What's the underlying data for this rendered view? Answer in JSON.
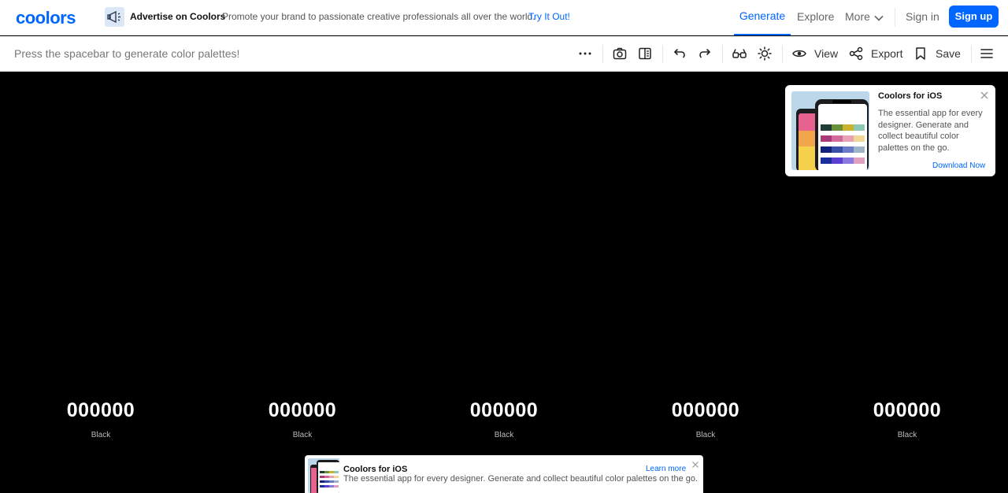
{
  "header": {
    "logo": "coolors",
    "ad": {
      "icon": "megaphone-icon",
      "title": "Advertise on Coolors",
      "text": "Promote your brand to passionate creative professionals all over the world.",
      "link": "Try It Out!"
    },
    "nav": {
      "generate": "Generate",
      "explore": "Explore",
      "more": "More",
      "signin": "Sign in",
      "signup": "Sign up"
    },
    "active_tab": "Generate"
  },
  "toolbar": {
    "hint": "Press the spacebar to generate color palettes!",
    "view_label": "View",
    "export_label": "Export",
    "save_label": "Save",
    "icons": [
      "more-dots-icon",
      "camera-icon",
      "layout-icon",
      "undo-icon",
      "redo-icon",
      "glasses-icon",
      "sun-icon",
      "eye-icon",
      "share-icon",
      "bookmark-icon",
      "menu-icon"
    ]
  },
  "palette": {
    "colors": [
      {
        "hex": "000000",
        "name": "Black"
      },
      {
        "hex": "000000",
        "name": "Black"
      },
      {
        "hex": "000000",
        "name": "Black"
      },
      {
        "hex": "000000",
        "name": "Black"
      },
      {
        "hex": "000000",
        "name": "Black"
      }
    ]
  },
  "ios_card": {
    "title": "Coolors for iOS",
    "text": "The essential app for every designer. Generate and collect beautiful color palettes on the go.",
    "link": "Download Now"
  },
  "bottom_banner": {
    "title": "Coolors for iOS",
    "text": "The essential app for every designer. Generate and collect beautiful color palettes on the go.",
    "link": "Learn more"
  },
  "colors": {
    "accent": "#0066ff",
    "background": "#000000",
    "panel": "#ffffff"
  }
}
